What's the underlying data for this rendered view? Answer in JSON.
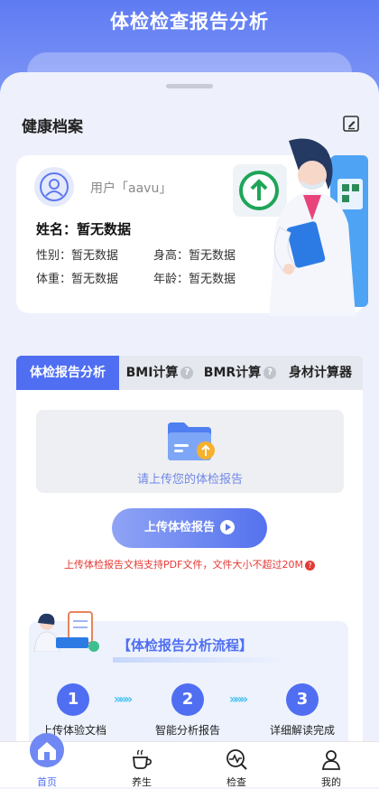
{
  "header": {
    "title": "体检检查报告分析"
  },
  "profile": {
    "section_title": "健康档案",
    "username": "用户「aavu」",
    "name": "姓名：暂无数据",
    "gender": "性别：暂无数据",
    "height": "身高：暂无数据",
    "weight": "体重：暂无数据",
    "age": "年龄：暂无数据"
  },
  "tabs": [
    {
      "label": "体检报告分析",
      "active": true
    },
    {
      "label": "BMI计算",
      "help": "?"
    },
    {
      "label": "BMR计算",
      "help": "?"
    },
    {
      "label": "身材计算器"
    }
  ],
  "upload": {
    "hint": "请上传您的体检报告",
    "button": "上传体检报告",
    "note": "上传体检报告文档支持PDF文件，文件大小不超过20M",
    "note_icon": "?"
  },
  "flow": {
    "title": "【体检报告分析流程】",
    "steps": [
      {
        "num": "1",
        "label": "上传体验文档"
      },
      {
        "num": "2",
        "label": "智能分析报告"
      },
      {
        "num": "3",
        "label": "详细解读完成"
      }
    ],
    "arrow": "»»»"
  },
  "nav": [
    {
      "label": "首页",
      "icon": "home-icon",
      "active": true
    },
    {
      "label": "养生",
      "icon": "tea-cup-icon"
    },
    {
      "label": "检查",
      "icon": "health-check-icon"
    },
    {
      "label": "我的",
      "icon": "user-icon"
    }
  ],
  "colors": {
    "accent": "#4f6ef2",
    "warning": "#e53935",
    "arrow": "#46c2f2"
  }
}
